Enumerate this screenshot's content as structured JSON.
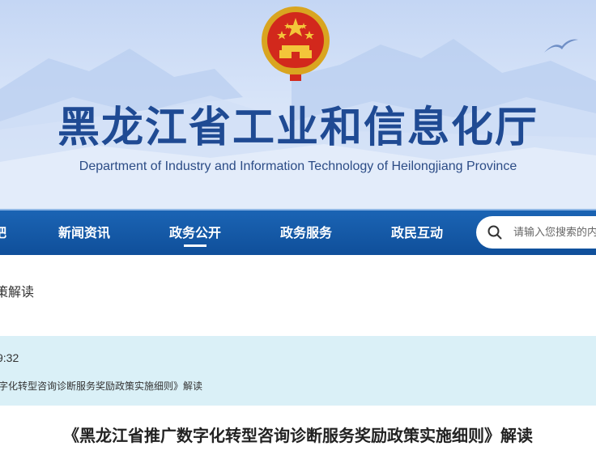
{
  "header": {
    "title_cn": "黑龙江省工业和信息化厅",
    "title_en": "Department of Industry and Information Technology of Heilongjiang Province",
    "emblem_icon": "national-emblem-icon"
  },
  "nav": {
    "items": [
      {
        "label": "吧"
      },
      {
        "label": "新闻资讯"
      },
      {
        "label": "政务公开"
      },
      {
        "label": "政务服务"
      },
      {
        "label": "政民互动"
      }
    ],
    "active": "政务公开",
    "bg_color": "#135aa8"
  },
  "search": {
    "placeholder": "请输入您搜索的内容",
    "icon": "search-icon"
  },
  "breadcrumb": {
    "text": "策解读"
  },
  "info": {
    "time": "9:32",
    "related": "字化转型咨询诊断服务奖励政策实施细则》解读",
    "bg_color": "#daf0f7"
  },
  "article": {
    "title": "《黑龙江省推广数字化转型咨询诊断服务奖励政策实施细则》解读"
  }
}
